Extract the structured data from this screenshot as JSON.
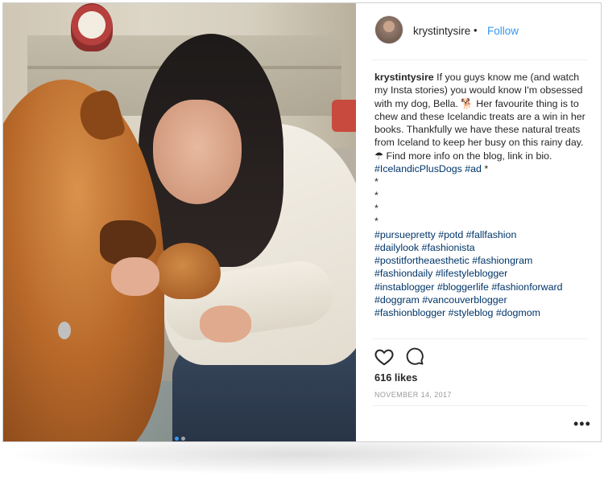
{
  "post": {
    "username": "krystintysire",
    "separator": "•",
    "follow_label": "Follow",
    "caption_user": "krystintysire",
    "caption_text": "If you guys know me (and watch my Insta stories) you would know I'm obsessed with my dog, Bella. 🐕 Her favourite thing is to chew and these Icelandic treats are a win in her books. Thankfully we have these natural treats from Iceland to keep her busy on this rainy day. ☂ Find more info on the blog, link in bio.",
    "caption_tags_inline": "#IcelandicPlusDogs #ad",
    "caption_star": "*",
    "stars": [
      "*",
      "*",
      "*",
      "*"
    ],
    "hashtags": [
      "#pursuepretty #potd #fallfashion",
      "#dailylook #fashionista",
      "#postitfortheaesthetic #fashiongram",
      "#fashiondaily #lifestyleblogger",
      "#instablogger #bloggerlife #fashionforward",
      "#doggram #vancouverblogger",
      "#fashionblogger #styleblog #dogmom"
    ],
    "likes": "616 likes",
    "date": "NOVEMBER 14, 2017",
    "more": "•••"
  },
  "icons": {
    "like": "heart-icon",
    "comment": "comment-icon",
    "more": "more-options-icon"
  },
  "carousel": {
    "count": 2,
    "active_index": 0
  },
  "colors": {
    "link": "#3897f0",
    "hashtag": "#003569",
    "text": "#262626",
    "muted": "#999999"
  }
}
